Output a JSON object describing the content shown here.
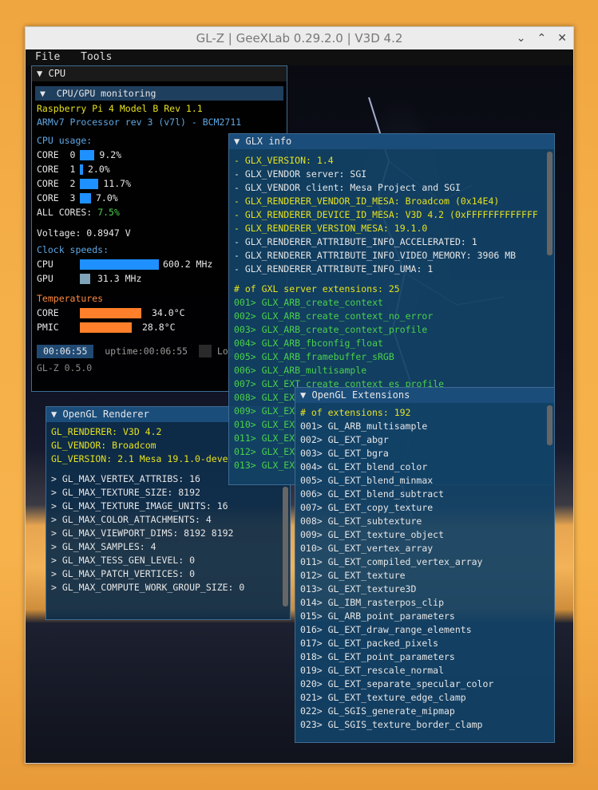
{
  "window": {
    "title": "GL-Z | GeeXLab 0.29.2.0 | V3D 4.2"
  },
  "menu": {
    "file": "File",
    "tools": "Tools"
  },
  "cpu_panel": {
    "title": "CPU",
    "section": "CPU/GPU monitoring",
    "model": "Raspberry Pi 4 Model B Rev 1.1",
    "processor": "ARMv7 Processor rev 3 (v7l) - BCM2711",
    "usage_label": "CPU usage:",
    "cores": [
      {
        "label": "CORE  0",
        "value": "9.2%",
        "pct": 9.2
      },
      {
        "label": "CORE  1",
        "value": "2.0%",
        "pct": 2.0
      },
      {
        "label": "CORE  2",
        "value": "11.7%",
        "pct": 11.7
      },
      {
        "label": "CORE  3",
        "value": "7.0%",
        "pct": 7.0
      }
    ],
    "all_cores_label": "ALL CORES:",
    "all_cores_value": "7.5%",
    "voltage": "Voltage: 0.8947 V",
    "clock_label": "Clock speeds:",
    "cpu_clock_label": "CPU",
    "cpu_clock_value": "600.2 MHz",
    "cpu_clock_fraction": 0.55,
    "gpu_clock_label": "GPU",
    "gpu_clock_value": "31.3 MHz",
    "gpu_clock_fraction": 0.07,
    "temps_label": "Temperatures",
    "core_temp_label": "CORE",
    "core_temp_value": "34.0°C",
    "core_temp_fraction": 0.43,
    "pmic_temp_label": "PMIC",
    "pmic_temp_value": "28.8°C",
    "pmic_temp_fraction": 0.36,
    "timer": "00:06:55",
    "uptime": "uptime:00:06:55",
    "log_label": "Log",
    "version": "GL-Z 0.5.0"
  },
  "renderer_panel": {
    "title": "OpenGL Renderer",
    "info": [
      "GL_RENDERER: V3D 4.2",
      "GL_VENDOR: Broadcom",
      "GL_VERSION: 2.1 Mesa 19.1.0-devel"
    ],
    "limits": [
      "> GL_MAX_VERTEX_ATTRIBS: 16",
      "> GL_MAX_TEXTURE_SIZE: 8192",
      "> GL_MAX_TEXTURE_IMAGE_UNITS: 16",
      "> GL_MAX_COLOR_ATTACHMENTS: 4",
      "> GL_MAX_VIEWPORT_DIMS: 8192 8192",
      "> GL_MAX_SAMPLES: 4",
      "> GL_MAX_TESS_GEN_LEVEL: 0",
      "> GL_MAX_PATCH_VERTICES: 0",
      "> GL_MAX_COMPUTE_WORK_GROUP_SIZE: 0"
    ]
  },
  "glx_panel": {
    "title": "GLX info",
    "yellow_1": [
      "- GLX_VERSION: 1.4"
    ],
    "white_1": [
      "- GLX_VENDOR server: SGI",
      "- GLX_VENDOR client: Mesa Project and SGI"
    ],
    "yellow_2": [
      "- GLX_RENDERER_VENDOR_ID_MESA: Broadcom (0x14E4)",
      "- GLX_RENDERER_DEVICE_ID_MESA: V3D 4.2 (0xFFFFFFFFFFFFF",
      "- GLX_RENDERER_VERSION_MESA: 19.1.0"
    ],
    "white_2": [
      "- GLX_RENDERER_ATTRIBUTE_INFO_ACCELERATED: 1",
      "- GLX_RENDERER_ATTRIBUTE_INFO_VIDEO_MEMORY: 3906 MB",
      "- GLX_RENDERER_ATTRIBUTE_INFO_UMA: 1"
    ],
    "ext_header": "# of GXL server extensions: 25",
    "extensions": [
      "001> GLX_ARB_create_context",
      "002> GLX_ARB_create_context_no_error",
      "003> GLX_ARB_create_context_profile",
      "004> GLX_ARB_fbconfig_float",
      "005> GLX_ARB_framebuffer_sRGB",
      "006> GLX_ARB_multisample",
      "007> GLX_EXT_create_context_es_profile",
      "008> GLX_EX",
      "009> GLX_EX",
      "010> GLX_EX",
      "011> GLX_EX",
      "012> GLX_EX",
      "013> GLX_EX"
    ]
  },
  "ext_panel": {
    "title": "OpenGL Extensions",
    "header": "# of extensions: 192",
    "items": [
      "001> GL_ARB_multisample",
      "002> GL_EXT_abgr",
      "003> GL_EXT_bgra",
      "004> GL_EXT_blend_color",
      "005> GL_EXT_blend_minmax",
      "006> GL_EXT_blend_subtract",
      "007> GL_EXT_copy_texture",
      "008> GL_EXT_subtexture",
      "009> GL_EXT_texture_object",
      "010> GL_EXT_vertex_array",
      "011> GL_EXT_compiled_vertex_array",
      "012> GL_EXT_texture",
      "013> GL_EXT_texture3D",
      "014> GL_IBM_rasterpos_clip",
      "015> GL_ARB_point_parameters",
      "016> GL_EXT_draw_range_elements",
      "017> GL_EXT_packed_pixels",
      "018> GL_EXT_point_parameters",
      "019> GL_EXT_rescale_normal",
      "020> GL_EXT_separate_specular_color",
      "021> GL_EXT_texture_edge_clamp",
      "022> GL_SGIS_generate_mipmap",
      "023> GL_SGIS_texture_border_clamp"
    ]
  },
  "colors": {
    "accent": "#1a4d7a",
    "bar_blue": "#1e90ff",
    "bar_orange": "#ff7f2a",
    "yellow": "#e6e21f",
    "green": "#4ad14a"
  }
}
